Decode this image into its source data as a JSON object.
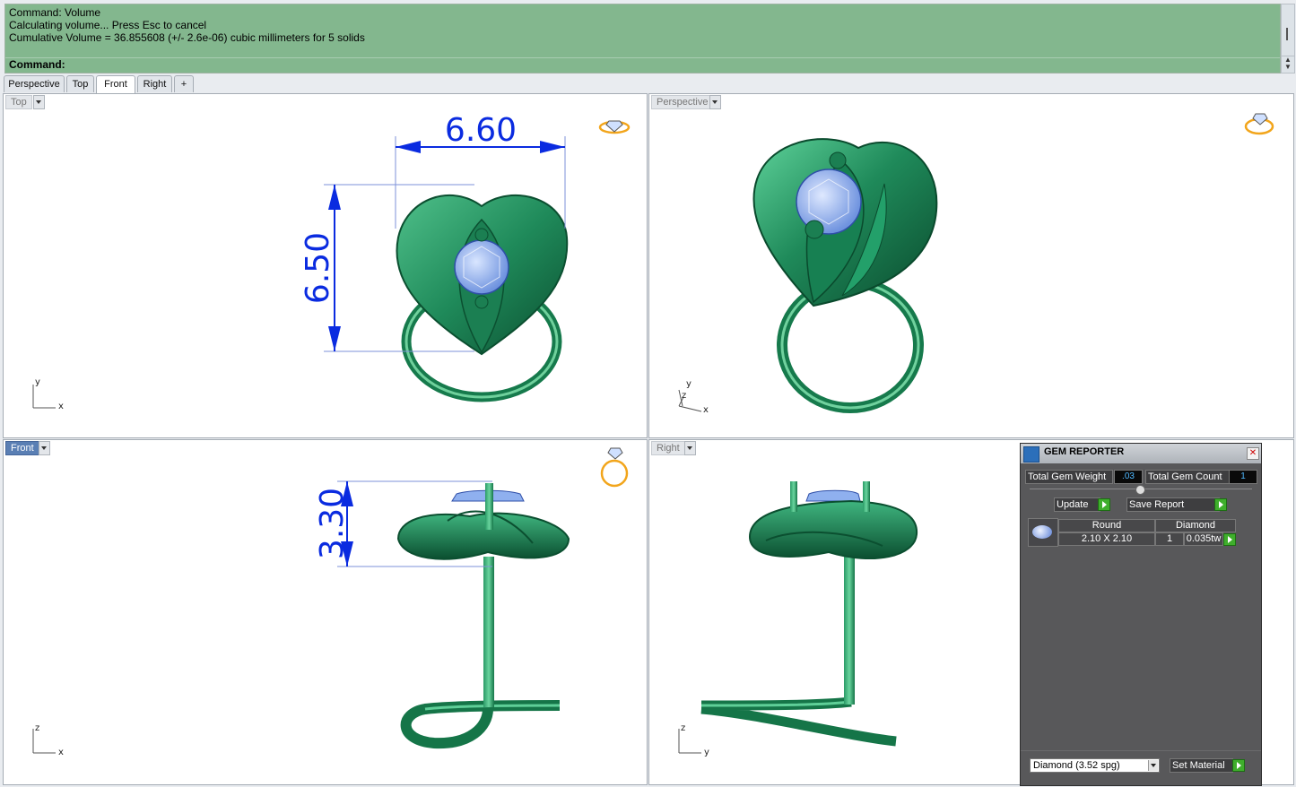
{
  "command_area": {
    "lines": [
      "Command: Volume",
      "Calculating volume... Press Esc to cancel",
      "Cumulative Volume = 36.855608 (+/- 2.6e-06) cubic millimeters for 5 solids"
    ],
    "prompt": "Command:"
  },
  "tabs": [
    "Perspective",
    "Top",
    "Front",
    "Right",
    "+"
  ],
  "active_tab": "Front",
  "viewports": {
    "top": {
      "label": "Top",
      "dim_width": "6.60",
      "dim_height": "6.50",
      "axis_a": "y",
      "axis_b": "x"
    },
    "perspective": {
      "label": "Perspective",
      "axis_a": "y",
      "axis_c": "z",
      "axis_b": "x"
    },
    "front": {
      "label": "Front",
      "dim_height": "3.30",
      "axis_a": "z",
      "axis_b": "x"
    },
    "right": {
      "label": "Right",
      "axis_a": "z",
      "axis_b": "y"
    }
  },
  "gem_reporter": {
    "title": "GEM REPORTER",
    "total_weight_label": "Total Gem Weight",
    "total_weight_value": ".03",
    "total_count_label": "Total Gem Count",
    "total_count_value": "1",
    "update_label": "Update",
    "save_report_label": "Save Report",
    "row": {
      "shape": "Round",
      "size": "2.10 X 2.10",
      "qty": "1",
      "material": "Diamond",
      "weight": "0.035tw"
    },
    "material_select": "Diamond    (3.52 spg)",
    "set_material_label": "Set Material"
  },
  "colors": {
    "command_bg": "#83b78e",
    "metal": "#1f8a5a",
    "gem": "#8fb0ef",
    "dimension": "#0a2be0",
    "active_label": "#5a7fb4"
  }
}
